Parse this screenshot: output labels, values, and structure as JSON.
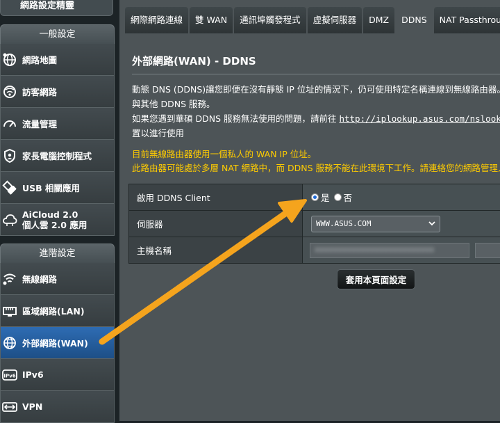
{
  "sidebar": {
    "top_label": "網路設定精靈",
    "general_header": "一般設定",
    "general_items": [
      {
        "label": "網路地圖",
        "icon": "globe-icon"
      },
      {
        "label": "訪客網路",
        "icon": "guest-network-icon"
      },
      {
        "label": "流量管理",
        "icon": "gauge-icon"
      },
      {
        "label": "家長電腦控制程式",
        "icon": "shield-icon"
      },
      {
        "label": "USB 相關應用",
        "icon": "usb-icon"
      },
      {
        "label": "AiCloud 2.0\n個人雲 2.0 應用",
        "icon": "cloud-icon"
      }
    ],
    "advanced_header": "進階設定",
    "advanced_items": [
      {
        "label": "無線網路",
        "icon": "wifi-icon"
      },
      {
        "label": "區域網路(LAN)",
        "icon": "lan-icon"
      },
      {
        "label": "外部網路(WAN)",
        "icon": "wan-globe-icon",
        "active": true
      },
      {
        "label": "IPv6",
        "icon": "ipv6-icon"
      },
      {
        "label": "VPN",
        "icon": "vpn-icon"
      }
    ]
  },
  "tabs": [
    {
      "label": "網際網路連線"
    },
    {
      "label": "雙 WAN"
    },
    {
      "label": "通訊埠觸發程式"
    },
    {
      "label": "虛擬伺服器"
    },
    {
      "label": "DMZ"
    },
    {
      "label": "DDNS",
      "active": true
    },
    {
      "label": "NAT Passthrough"
    }
  ],
  "page": {
    "title": "外部網路(WAN) - DDNS",
    "desc_line1": "動態 DNS (DDNS)讓您即便在沒有靜態 IP 位址的情況下，仍可使用特定名稱連線到無線路由器。無",
    "desc_line2": "與其他 DDNS 服務。",
    "desc_line3_prefix": "如果您遇到華碩 DDNS 服務無法使用的問題，請前往 ",
    "desc_url": "http://iplookup.asus.com/nslookup",
    "desc_line4": "置以進行使用",
    "warn_line1": "目前無線路由器使用一個私人的 WAN IP 位址。",
    "warn_line2": "此路由器可能處於多層 NAT 網路中，而 DDNS 服務不能在此環境下工作。請連絡您的網路管理人員"
  },
  "form": {
    "enable_label": "啟用 DDNS Client",
    "yes_label": "是",
    "no_label": "否",
    "enabled": true,
    "server_label": "伺服器",
    "server_value": "WWW.ASUS.COM",
    "host_label": "主機名稱",
    "host_value": "xxxxxxxxxxxxxxxxxxxxxxxxxx"
  },
  "apply_button": "套用本頁面設定",
  "colors": {
    "warning": "#ffcc00",
    "active_item": "#2e6cb3",
    "annotation_arrow": "#f5a41d"
  }
}
